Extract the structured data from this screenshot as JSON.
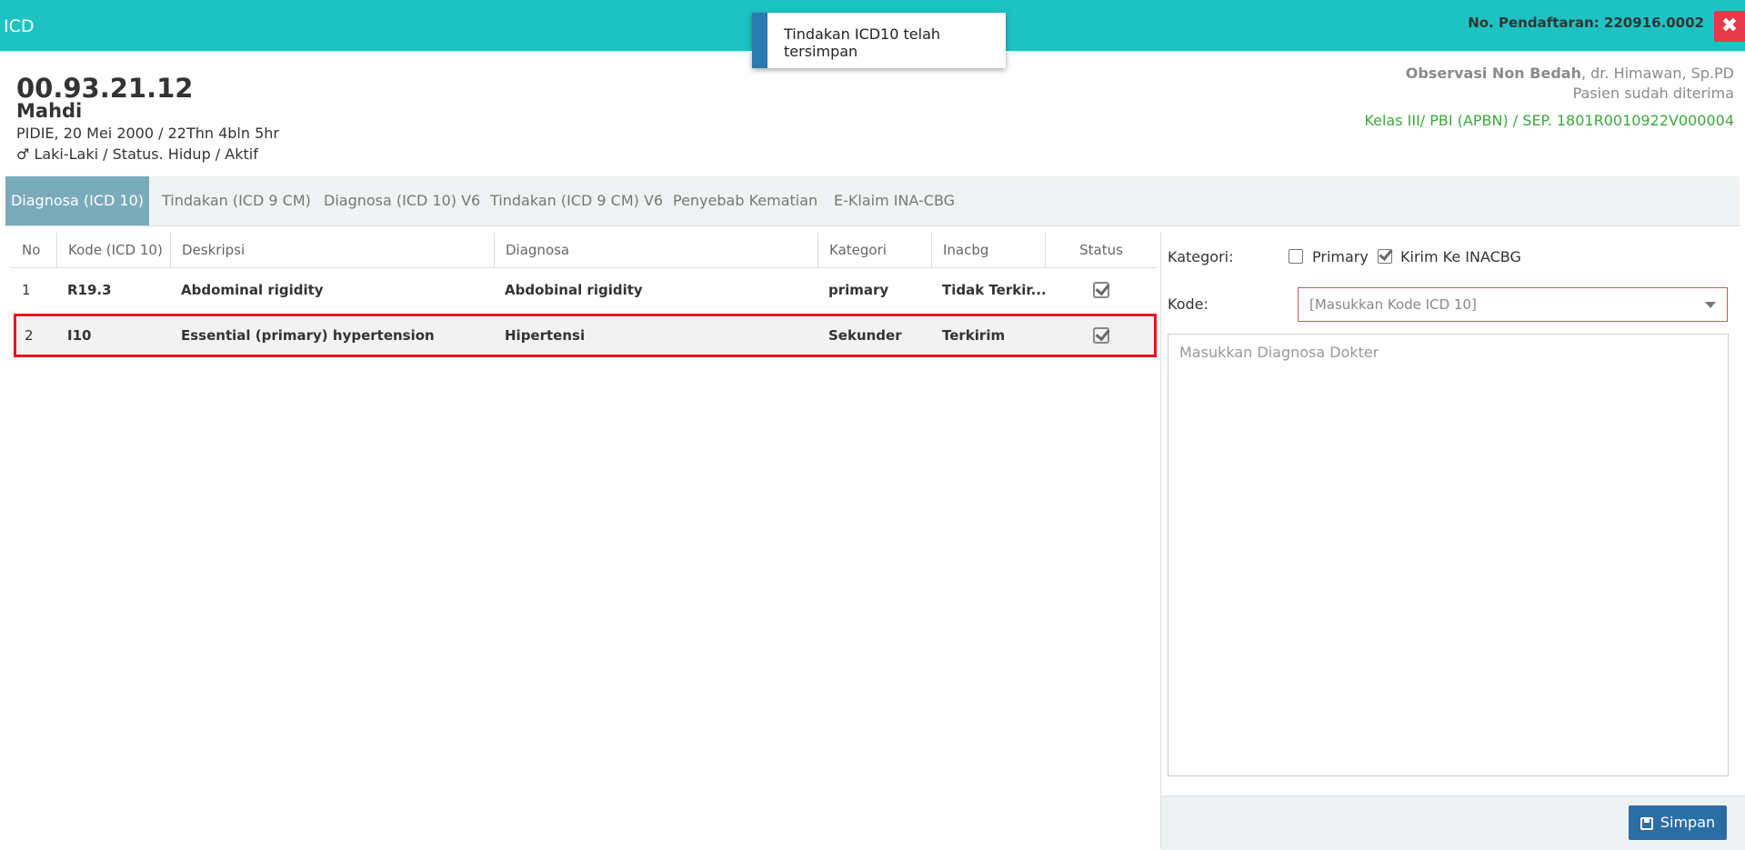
{
  "window": {
    "title": "ICD",
    "registration": "No. Pendaftaran: 220916.0002",
    "close_symbol": "✖"
  },
  "toast": {
    "message": "Tindakan ICD10 telah tersimpan"
  },
  "patient": {
    "number": "00.93.21.12",
    "name": "Mahdi",
    "birth": "PIDIE, 20 Mei 2000 / 22Thn 4bln 5hr",
    "gender_symbol": "♂",
    "status": "Laki-Laki / Status. Hidup / Aktif"
  },
  "visit": {
    "unit": "Observasi Non Bedah",
    "doctor": ", dr. Himawan, Sp.PD",
    "admission": "Pasien sudah diterima",
    "class_info": "Kelas III/ PBI (APBN) / SEP. 1801R0010922V000004",
    "class_color": "#3ca83c"
  },
  "tabs": [
    {
      "label": "Diagnosa (ICD 10)",
      "active": true
    },
    {
      "label": "Tindakan (ICD 9 CM)"
    },
    {
      "label": "Diagnosa (ICD 10) V6"
    },
    {
      "label": "Tindakan (ICD 9 CM) V6"
    },
    {
      "label": "Penyebab Kematian"
    },
    {
      "label": "E-Klaim INA-CBG"
    }
  ],
  "table": {
    "headers": [
      "No",
      "Kode (ICD 10)",
      "Deskripsi",
      "Diagnosa",
      "Kategori",
      "Inacbg",
      "Status"
    ],
    "rows": [
      {
        "no": "1",
        "kode": "R19.3",
        "deskripsi": "Abdominal rigidity",
        "diagnosa": "Abdobinal rigidity",
        "kategori": "primary",
        "inacbg": "Tidak Terkir...",
        "status_icon": "checked-square-icon"
      },
      {
        "no": "2",
        "kode": "I10",
        "deskripsi": "Essential (primary) hypertension",
        "diagnosa": "Hipertensi",
        "kategori": "Sekunder",
        "inacbg": "Terkirim",
        "status_icon": "checked-square-icon"
      }
    ],
    "highlight_color": "#e8141d"
  },
  "form": {
    "kategori_label": "Kategori:",
    "primary_label": "Primary",
    "primary_checked": false,
    "kirim_label": "Kirim Ke INACBG",
    "kirim_checked": true,
    "kode_label": "Kode:",
    "kode_placeholder": "[Masukkan Kode ICD 10]",
    "diagnosa_placeholder": "Masukkan Diagnosa Dokter",
    "save_label": "Simpan"
  }
}
